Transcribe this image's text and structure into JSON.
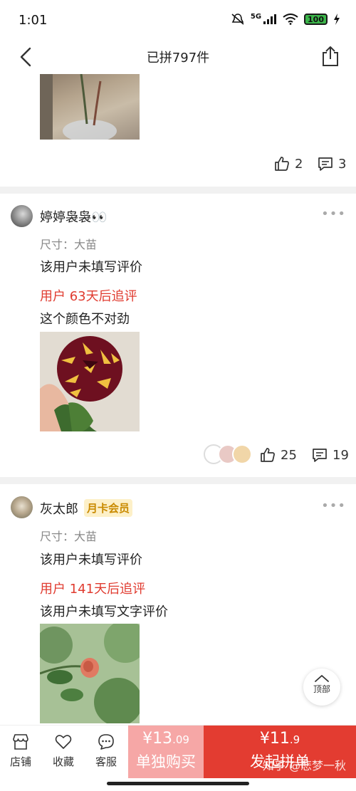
{
  "status_bar": {
    "time": "1:01",
    "network": "5G",
    "battery": "100"
  },
  "nav": {
    "title": "已拼797件"
  },
  "previous_review": {
    "likes": "2",
    "comments": "3"
  },
  "reviews": [
    {
      "username": "婷婷袅袅👀",
      "spec": "尺寸：大苗",
      "text": "该用户未填写评价",
      "followup_label": "用户 63天后追评",
      "followup_text": "这个颜色不对劲",
      "likes": "25",
      "comments": "19"
    },
    {
      "username": "灰太郎",
      "badge": "月卡会员",
      "spec": "尺寸：大苗",
      "text": "该用户未填写评价",
      "followup_label": "用户 141天后追评",
      "followup_text": "该用户未填写文字评价"
    }
  ],
  "float": {
    "top_label": "顶部"
  },
  "bottom_bar": {
    "tabs": [
      {
        "label": "店铺",
        "icon": "store-icon"
      },
      {
        "label": "收藏",
        "icon": "heart-icon"
      },
      {
        "label": "客服",
        "icon": "chat-icon"
      }
    ],
    "single": {
      "currency": "¥",
      "price_int": "13",
      "price_dec": ".09",
      "label": "单独购买"
    },
    "group": {
      "currency": "¥",
      "price_int": "11",
      "price_dec": ".9",
      "label": "发起拼单"
    }
  },
  "watermark": "知乎 @悲梦一秋",
  "colors": {
    "accent": "#e33c31",
    "single_button": "#f6a7a6",
    "followup": "#e03b2f",
    "badge": "#c98a00"
  }
}
